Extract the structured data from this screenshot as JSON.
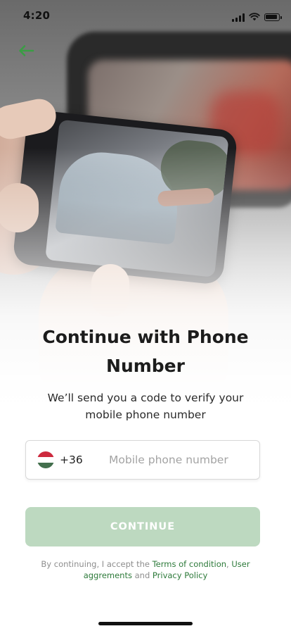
{
  "status_bar": {
    "time": "4:20",
    "icons": [
      "cellular-signal-icon",
      "wifi-icon",
      "battery-icon"
    ]
  },
  "header": {
    "back_icon": "arrow-left-icon",
    "accent_color": "#3a9d44"
  },
  "hero_image": {
    "subject": "hands holding smartphone photographing car damage"
  },
  "content": {
    "title": "Continue with Phone Number",
    "subtitle": "We’ll send you a code to verify your mobile phone number"
  },
  "phone_field": {
    "country_flag": "hungary-flag-icon",
    "country_code": "+36",
    "value": "",
    "placeholder": "Mobile phone number"
  },
  "continue_button": {
    "label": "CONTINUE",
    "color": "#bdd9c0",
    "state": "disabled"
  },
  "terms": {
    "prefix": "By continuing, I accept the ",
    "terms_link": "Terms of condition",
    "separator": ", ",
    "user_agreements_link": "User aggrements",
    "joiner": " and ",
    "privacy_link": "Privacy Policy",
    "link_color": "#2d7a3a"
  }
}
